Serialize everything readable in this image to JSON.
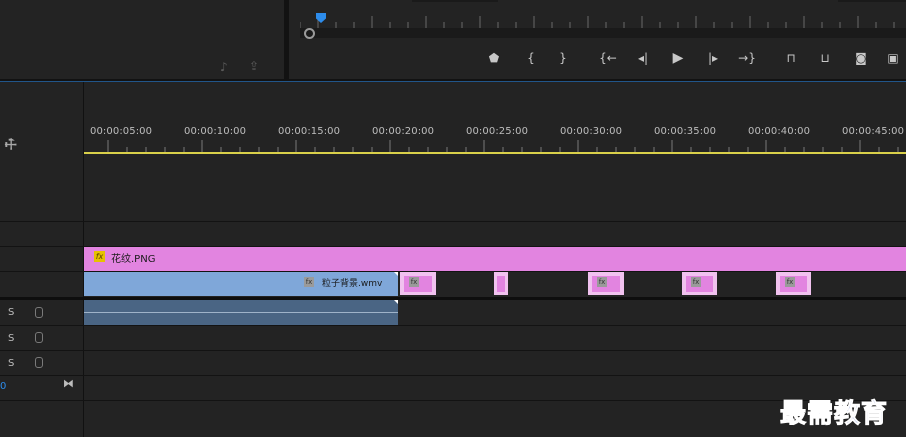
{
  "source_monitor": {
    "icons": [
      "insert-audio-icon",
      "export-frame-icon"
    ]
  },
  "program_monitor": {
    "controls": [
      {
        "name": "add-marker-button",
        "icon": "marker-icon",
        "glyph": "⬟"
      },
      {
        "name": "mark-in-button",
        "icon": "mark-in-icon",
        "glyph": "{"
      },
      {
        "name": "mark-out-button",
        "icon": "mark-out-icon",
        "glyph": "}"
      },
      {
        "name": "go-to-in-button",
        "icon": "go-to-in-icon",
        "glyph": "{←"
      },
      {
        "name": "step-back-button",
        "icon": "step-back-icon",
        "glyph": "◂|"
      },
      {
        "name": "play-button",
        "icon": "play-icon",
        "glyph": "▶"
      },
      {
        "name": "step-forward-button",
        "icon": "step-forward-icon",
        "glyph": "|▸"
      },
      {
        "name": "go-to-out-button",
        "icon": "go-to-out-icon",
        "glyph": "→}"
      },
      {
        "name": "lift-button",
        "icon": "lift-icon",
        "glyph": "⊓"
      },
      {
        "name": "extract-button",
        "icon": "extract-icon",
        "glyph": "⊔"
      },
      {
        "name": "export-frame-button",
        "icon": "camera-icon",
        "glyph": "◙"
      },
      {
        "name": "compare-view-button",
        "icon": "compare-icon",
        "glyph": "▣"
      }
    ]
  },
  "timeline": {
    "timecodes": [
      "00:00:05:00",
      "00:00:10:00",
      "00:00:15:00",
      "00:00:20:00",
      "00:00:25:00",
      "00:00:30:00",
      "00:00:35:00",
      "00:00:40:00",
      "00:00:45:00"
    ],
    "clips": {
      "png_clip": {
        "label": "花纹.PNG",
        "fx": "fx",
        "color": "#e284e0"
      },
      "video_clip": {
        "label": "粒子背景.wmv",
        "fx": "fx",
        "color": "#7fa7d9"
      },
      "audio_clip": {
        "color": "#4a6584"
      }
    },
    "audio_tracks": [
      {
        "solo": "S"
      },
      {
        "solo": "S"
      },
      {
        "solo": "S"
      }
    ],
    "master": {
      "value": "0"
    }
  },
  "colors": {
    "accent": "#2d8ceb",
    "playhead_range": "#d9d04a",
    "fx_badge": "#e6c200"
  },
  "watermark": "最需教育"
}
